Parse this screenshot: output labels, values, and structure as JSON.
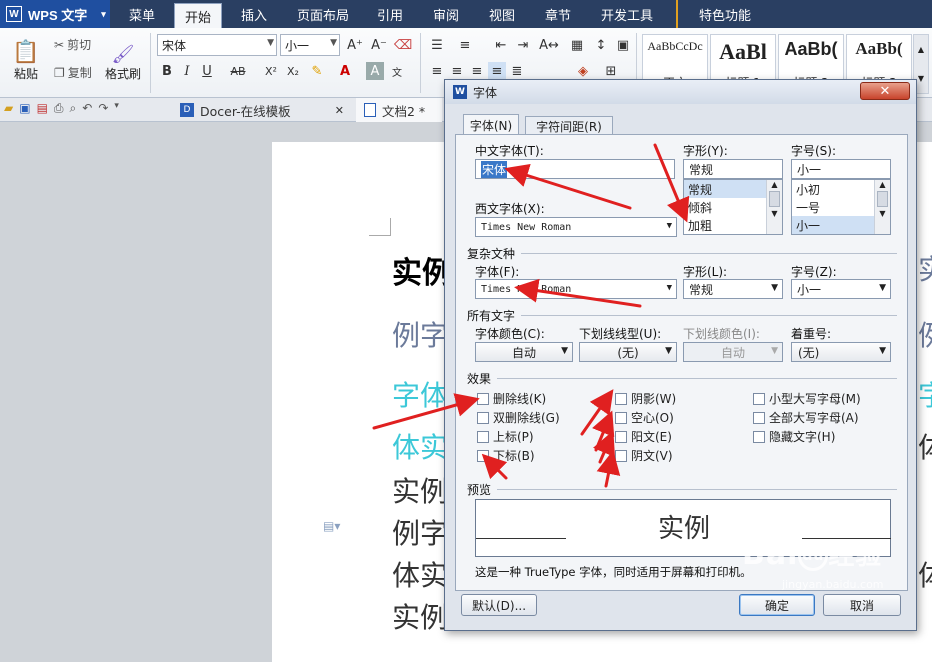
{
  "app": {
    "name": "WPS 文字"
  },
  "menu_tabs": [
    "菜单",
    "开始",
    "插入",
    "页面布局",
    "引用",
    "审阅",
    "视图",
    "章节",
    "开发工具",
    "特色功能"
  ],
  "ribbon": {
    "paste": "粘贴",
    "cut": "剪切",
    "copy": "复制",
    "format_painter": "格式刷",
    "font_name": "宋体",
    "font_size": "小一",
    "bold": "B",
    "italic": "I",
    "underline": "U",
    "strike": "AB",
    "superscript": "X²",
    "subscript": "X₂",
    "styles": [
      {
        "sample": "AaBbCcDc",
        "name": "正文"
      },
      {
        "sample": "AaBl",
        "name": "标题 1"
      },
      {
        "sample": "AaBb(",
        "name": "标题 2"
      },
      {
        "sample": "AaBb(",
        "name": "标题 3"
      }
    ]
  },
  "doc_tabs": [
    {
      "label": "Docer-在线模板",
      "close": "✕"
    },
    {
      "label": "文档2 *"
    }
  ],
  "document_lines": [
    {
      "text": "实例",
      "style": "bold"
    },
    {
      "text": "例字",
      "style": "grey"
    },
    {
      "text": "字体",
      "style": "cyan"
    },
    {
      "text": "体实",
      "style": "cyan"
    },
    {
      "text": "实例",
      "style": "normal"
    },
    {
      "text": "例字",
      "style": "normal"
    },
    {
      "text": "体实",
      "style": "normal"
    },
    {
      "text": "实例",
      "style": "normal"
    }
  ],
  "document_right_glyphs": [
    {
      "text": "实",
      "style": "grey"
    },
    {
      "text": "例",
      "style": "grey"
    },
    {
      "text": "字",
      "style": "cyan"
    },
    {
      "text": "体",
      "style": "normal"
    },
    {
      "text": "体",
      "style": "normal"
    }
  ],
  "dialog": {
    "title": "字体",
    "tabs": [
      "字体(N)",
      "字符间距(R)"
    ],
    "chinese_font_label": "中文字体(T):",
    "chinese_font_value": "宋体",
    "style_label": "字形(Y):",
    "style_value": "常规",
    "style_options": [
      "常规",
      "倾斜",
      "加粗"
    ],
    "size_label": "字号(S):",
    "size_value": "小一",
    "size_options": [
      "小初",
      "一号",
      "小一"
    ],
    "western_font_label": "西文字体(X):",
    "western_font_value": "Times New Roman",
    "complex_group": "复杂文种",
    "complex_font_label": "字体(F):",
    "complex_font_value": "Times New Roman",
    "complex_style_label": "字形(L):",
    "complex_style_value": "常规",
    "complex_size_label": "字号(Z):",
    "complex_size_value": "小一",
    "all_text_group": "所有文字",
    "font_color_label": "字体颜色(C):",
    "font_color_value": "自动",
    "underline_type_label": "下划线线型(U):",
    "underline_type_value": "(无)",
    "underline_color_label": "下划线颜色(I):",
    "underline_color_value": "自动",
    "emphasis_label": "着重号:",
    "emphasis_value": "(无)",
    "effects_group": "效果",
    "effects_col1": [
      "删除线(K)",
      "双删除线(G)",
      "上标(P)",
      "下标(B)"
    ],
    "effects_col2": [
      "阴影(W)",
      "空心(O)",
      "阳文(E)",
      "阴文(V)"
    ],
    "effects_col3": [
      "小型大写字母(M)",
      "全部大写字母(A)",
      "隐藏文字(H)"
    ],
    "preview_group": "预览",
    "preview_text": "实例",
    "preview_note": "这是一种 TrueType 字体，同时适用于屏幕和打印机。",
    "default_button": "默认(D)...",
    "ok_button": "确定",
    "cancel_button": "取消"
  },
  "watermark": {
    "brand": "Bai",
    "logo_char": "du",
    "site": "jingyan.baidu.com",
    "suffix": "经验"
  }
}
